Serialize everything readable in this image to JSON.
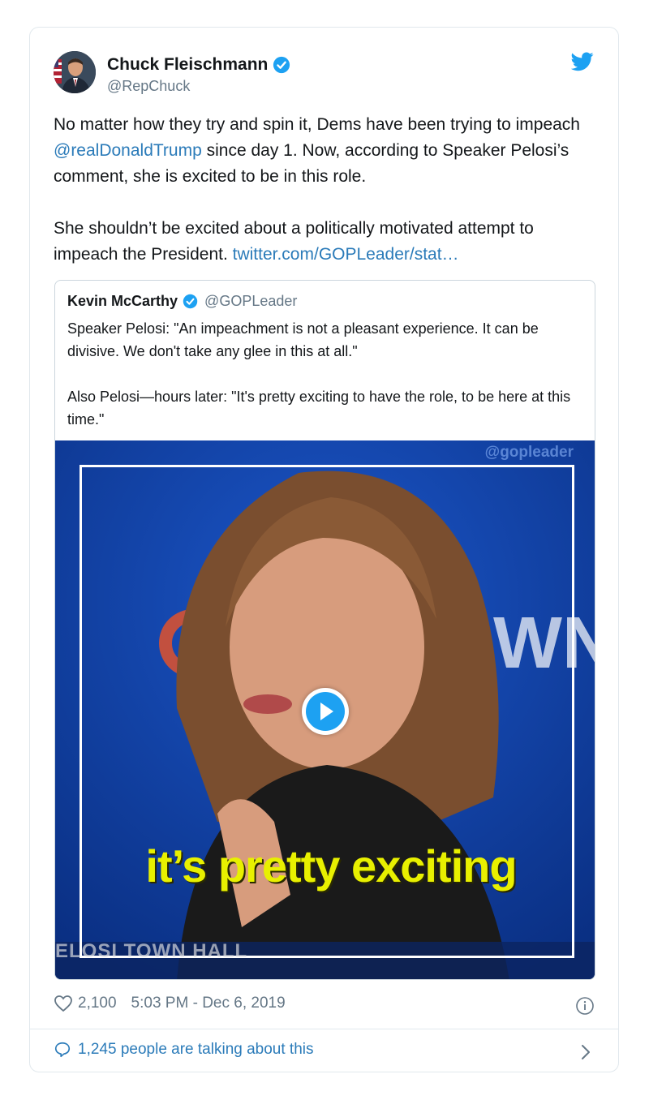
{
  "author": {
    "name": "Chuck Fleischmann",
    "handle": "@RepChuck",
    "verified": true
  },
  "tweet": {
    "paragraph1_before": "No matter how they try and spin it, Dems have been trying to impeach ",
    "mention": "@realDonaldTrump",
    "paragraph1_after": " since day 1. Now, according to Speaker Pelosi’s comment, she is excited to be in this role.",
    "paragraph2_before": "She shouldn’t be excited about a politically motivated attempt to impeach the President. ",
    "link": "twitter.com/GOPLeader/stat…"
  },
  "quoted": {
    "name": "Kevin McCarthy",
    "handle": "@GOPLeader",
    "paragraph1": "Speaker Pelosi: \"An impeachment is not a pleasant experience. It can be divisive. We don't take any glee in this at all.\"",
    "paragraph2": "Also Pelosi—hours later: \"It's pretty exciting to have the role, to be here at this time.\"",
    "video": {
      "watermark": "@gopleader",
      "caption": "it’s pretty exciting",
      "lower_third": "ELOSI TOWN HALL"
    }
  },
  "footer": {
    "likes": "2,100",
    "timestamp": "5:03 PM - Dec 6, 2019",
    "talking": "1,245 people are talking about this"
  },
  "colors": {
    "link": "#2b7bb9",
    "twitter_blue": "#1da1f2",
    "caption_yellow": "#e8f000"
  }
}
